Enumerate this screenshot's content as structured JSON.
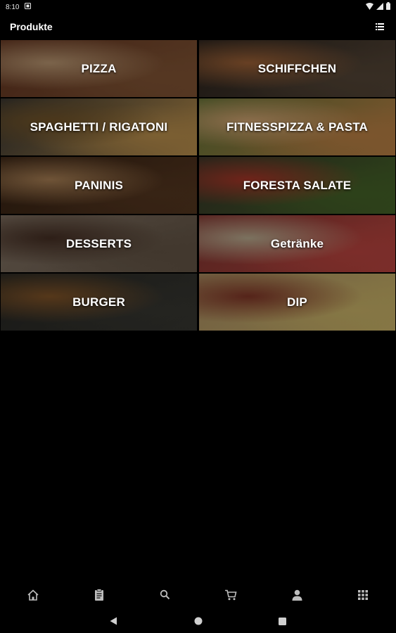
{
  "status_bar": {
    "time": "8:10"
  },
  "app_bar": {
    "title": "Produkte"
  },
  "categories": [
    {
      "label": "PIZZA",
      "colors": [
        "#8a5a38",
        "#c7a27a",
        "#6b3a24"
      ]
    },
    {
      "label": "SCHIFFCHEN",
      "colors": [
        "#5a4a3a",
        "#a8683a",
        "#2e2620"
      ]
    },
    {
      "label": "SPAGHETTI / RIGATONI",
      "colors": [
        "#c89a52",
        "#7a5a2c",
        "#3a3834"
      ]
    },
    {
      "label": "FITNESSPIZZA & PASTA",
      "colors": [
        "#c98a4a",
        "#e0b07a",
        "#6a7a3a"
      ]
    },
    {
      "label": "PANINIS",
      "colors": [
        "#5a3a22",
        "#b4885a",
        "#3a2414"
      ]
    },
    {
      "label": "FORESTA SALATE",
      "colors": [
        "#4a6a2a",
        "#b43a2a",
        "#3a3a2a"
      ]
    },
    {
      "label": "DESSERTS",
      "colors": [
        "#6a5a4a",
        "#4a3226",
        "#8a7a6a"
      ]
    },
    {
      "label": "Getränke",
      "colors": [
        "#c84a44",
        "#c8b89a",
        "#8a3a34"
      ]
    },
    {
      "label": "BURGER",
      "colors": [
        "#3a3a34",
        "#8a5a2a",
        "#2a2a26"
      ]
    },
    {
      "label": "DIP",
      "colors": [
        "#d8c070",
        "#8a3a2a",
        "#b89a6a"
      ]
    }
  ],
  "bottom_nav": [
    {
      "name": "home-icon"
    },
    {
      "name": "orders-icon"
    },
    {
      "name": "search-icon"
    },
    {
      "name": "cart-icon"
    },
    {
      "name": "account-icon"
    },
    {
      "name": "apps-grid-icon"
    }
  ],
  "colors": {
    "background": "#000000",
    "icon": "#bdbdbd",
    "text": "#ffffff"
  }
}
